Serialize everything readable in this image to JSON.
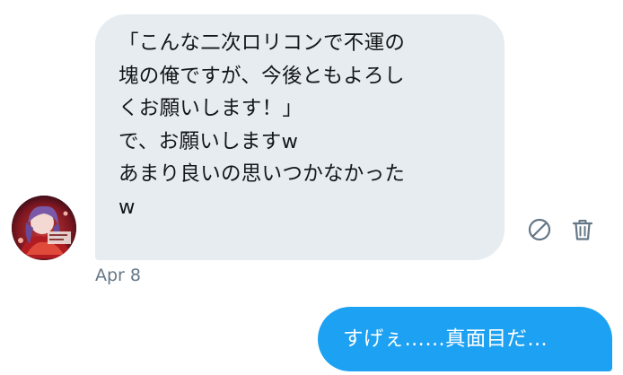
{
  "conversation": {
    "incoming_message": {
      "lines": [
        "「こんな二次ロリコンで不運の",
        "塊の俺ですが、今後ともよろし",
        "くお願いします！」",
        "で、お願いしますw",
        "あまり良いの思いつかなかった",
        "w"
      ],
      "timestamp": "Apr 8",
      "actions": {
        "report_icon": "report-icon",
        "delete_icon": "trash-icon"
      }
    },
    "outgoing_message": {
      "text": "すげぇ……真面目だ…"
    }
  },
  "colors": {
    "incoming_bubble": "#e6ecf0",
    "outgoing_bubble": "#1da1f2",
    "timestamp": "#657786",
    "icon": "#657786"
  }
}
